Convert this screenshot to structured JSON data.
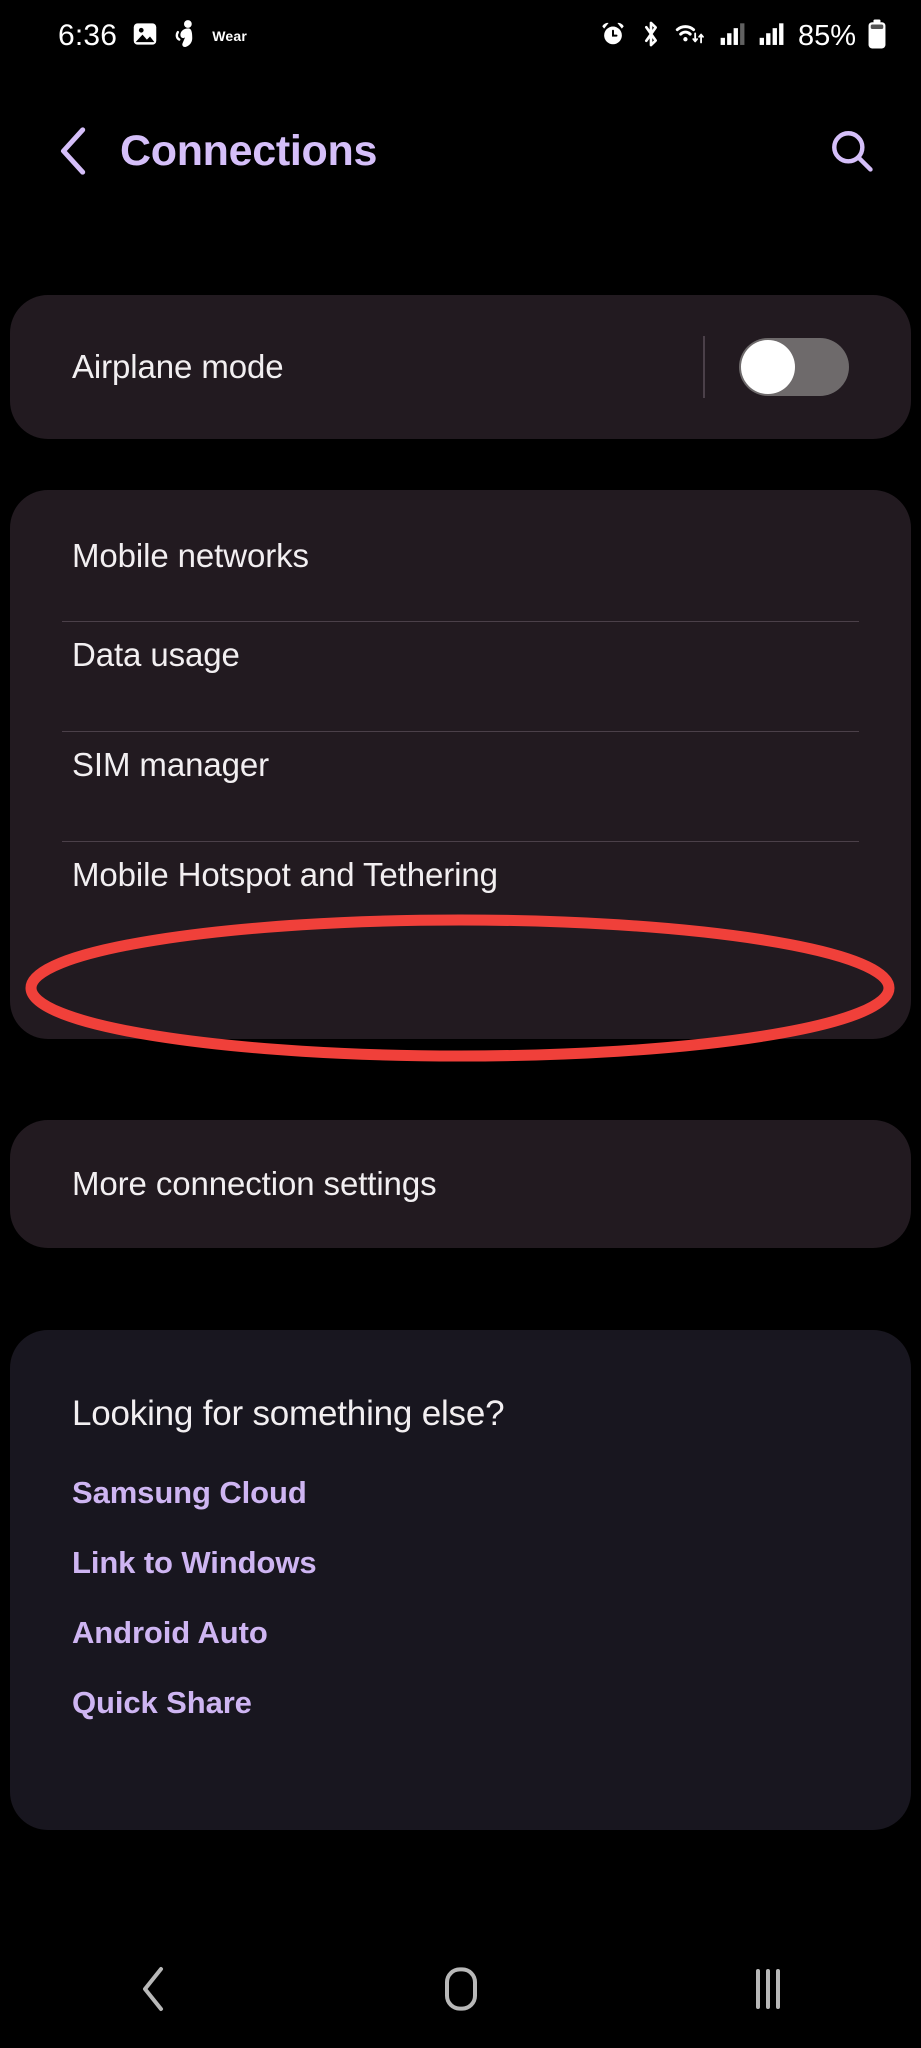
{
  "status_bar": {
    "clock": "6:36",
    "wear_label": "Wear",
    "battery_percent": "85%",
    "left_icons": [
      "gallery-image-icon",
      "wear-figure-icon"
    ],
    "right_icons": [
      "alarm-icon",
      "bluetooth-icon",
      "wifi-data-icon",
      "signal-bars-sim1-icon",
      "signal-bars-sim2-icon",
      "battery-icon"
    ]
  },
  "header": {
    "back_icon": "chevron-left-icon",
    "title": "Connections",
    "search_icon": "search-icon"
  },
  "airplane_card": {
    "label": "Airplane mode",
    "toggle_state": "off"
  },
  "network_card": {
    "rows": [
      {
        "label": "Mobile networks"
      },
      {
        "label": "Data usage"
      },
      {
        "label": "SIM manager"
      },
      {
        "label": "Mobile Hotspot and Tethering"
      }
    ]
  },
  "more_card": {
    "label": "More connection settings"
  },
  "looking_for_card": {
    "title": "Looking for something else?",
    "links": [
      {
        "label": "Samsung Cloud"
      },
      {
        "label": "Link to Windows"
      },
      {
        "label": "Android Auto"
      },
      {
        "label": "Quick Share"
      }
    ]
  },
  "annotation": {
    "type": "ellipse-highlight",
    "target": "Mobile Hotspot and Tethering",
    "color": "#F0403A"
  },
  "nav_bar": {
    "recents_icon": "recents-icon",
    "home_icon": "home-icon",
    "back_icon": "back-icon"
  },
  "colors": {
    "background": "#000000",
    "card": "#221A20",
    "card_tinted": "#18161F",
    "accent_purple": "#D5BFF9",
    "link_purple": "#CEB5F2",
    "text_primary": "#F2EFF1",
    "divider": "#4B4049",
    "highlight_red": "#F0403A"
  }
}
